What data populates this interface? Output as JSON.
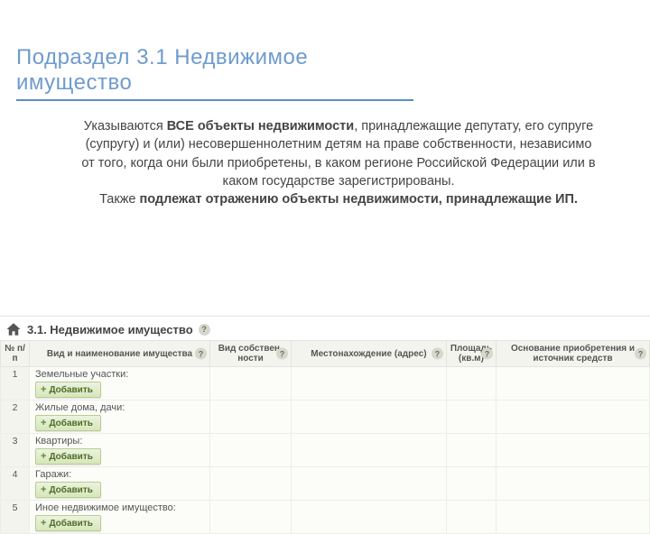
{
  "title": "Подраздел 3.1 Недвижимое имущество",
  "intro": {
    "lead": "Указываются ",
    "bold1": "ВСЕ объекты недвижимости",
    "mid": ", принадлежащие депутату, его супруге (супругу) и (или) несовершеннолетним детям на праве собственности, независимо от того, когда они были приобретены, в каком регионе Российской Федерации или в каком государстве зарегистрированы.",
    "also": "Также ",
    "bold2": "подлежат отражению объекты недвижимости, принадлежащие ИП."
  },
  "panel": {
    "heading": "3.1. Недвижимое имущество",
    "headers": {
      "num": "№ п/п",
      "name": "Вид и наименование имущества",
      "ownership": "Вид собствен-ности",
      "address": "Местонахождение (адрес)",
      "area": "Площадь (кв.м)",
      "basis": "Основание приобретения и источник средств"
    },
    "add_label": "Добавить",
    "rows": [
      {
        "n": "1",
        "category": "Земельные участки:"
      },
      {
        "n": "2",
        "category": "Жилые дома, дачи:"
      },
      {
        "n": "3",
        "category": "Квартиры:"
      },
      {
        "n": "4",
        "category": "Гаражи:"
      },
      {
        "n": "5",
        "category": "Иное недвижимое имущество:"
      }
    ]
  }
}
